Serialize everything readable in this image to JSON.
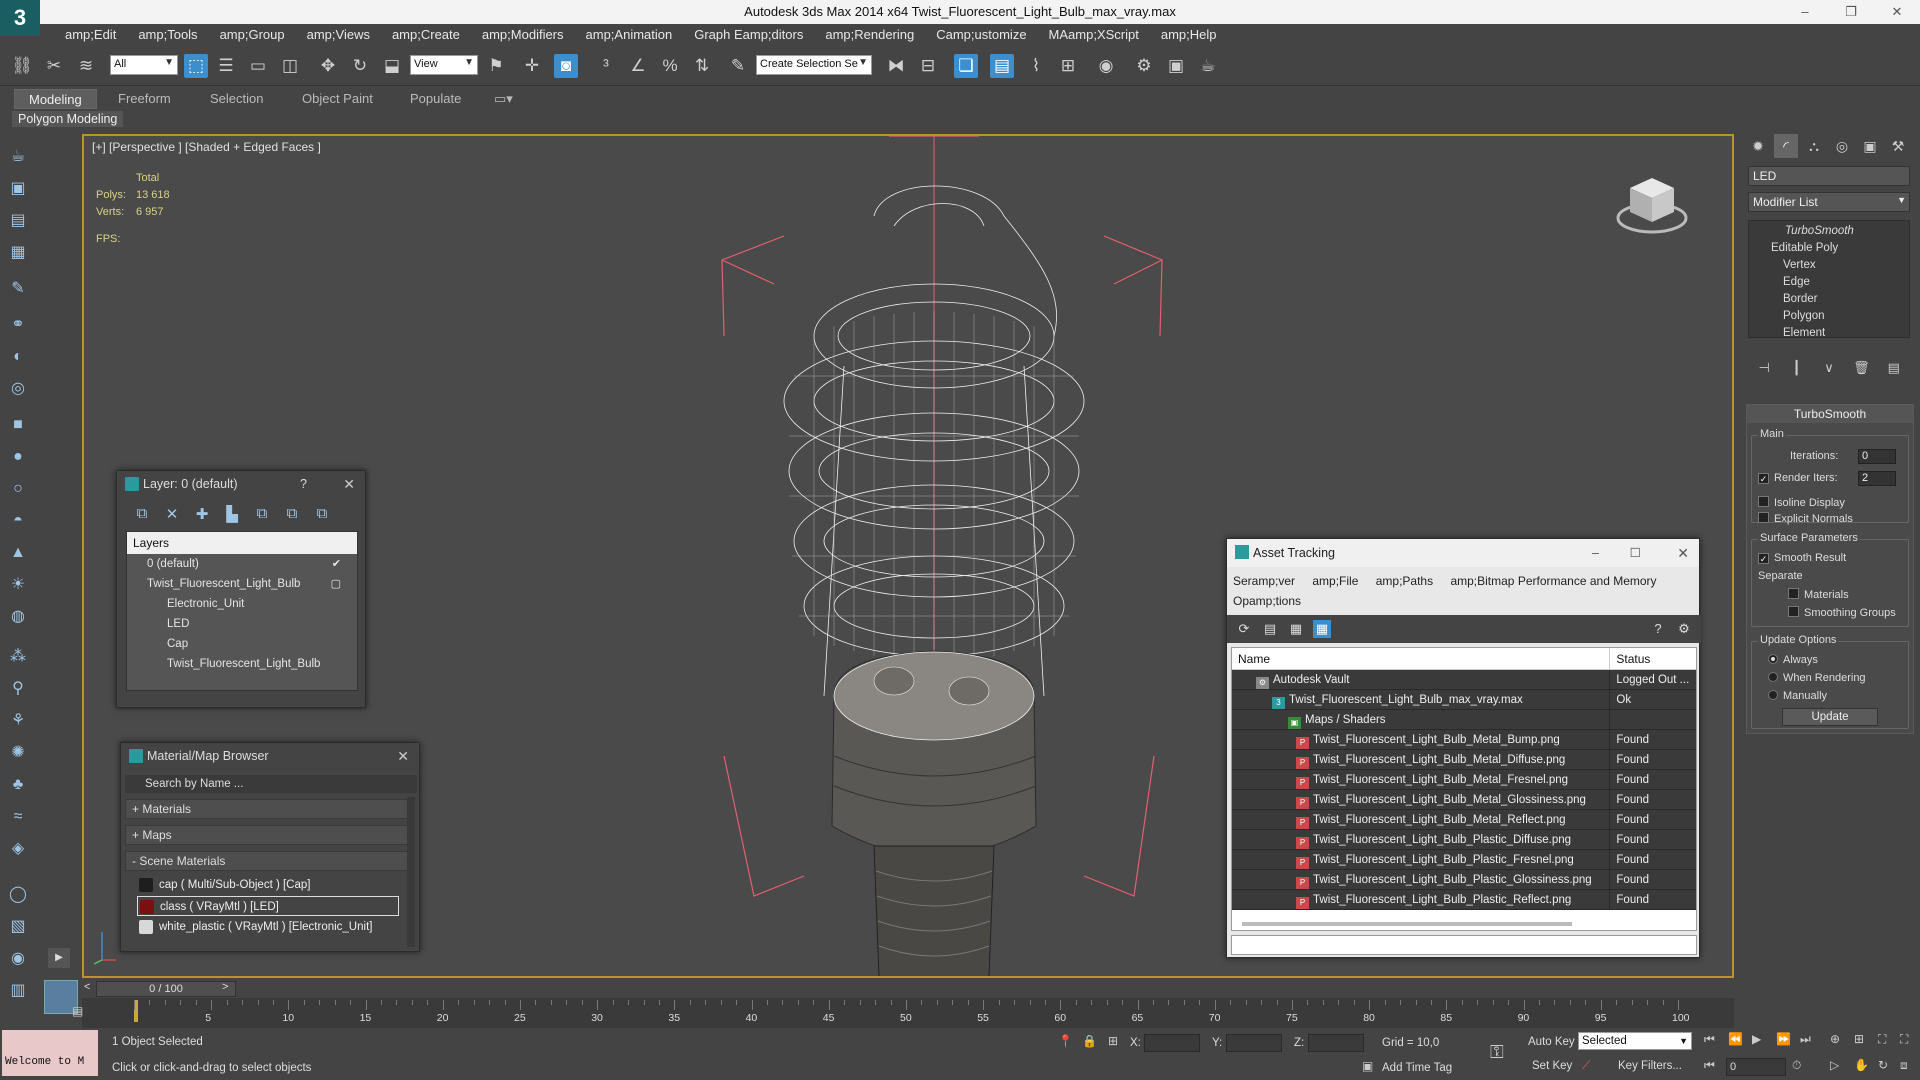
{
  "app": {
    "title": "Autodesk 3ds Max  2014 x64     Twist_Fluorescent_Light_Bulb_max_vray.max",
    "logo": "3",
    "controls": [
      "–",
      "❐",
      "✕"
    ]
  },
  "menu": [
    "amp;Edit",
    "amp;Tools",
    "amp;Group",
    "amp;Views",
    "amp;Create",
    "amp;Modifiers",
    "amp;Animation",
    "Graph Eamp;ditors",
    "amp;Rendering",
    "Camp;ustomize",
    "MAamp;XScript",
    "amp;Help"
  ],
  "toolbar": {
    "filter_value": "All",
    "refcoord_value": "View",
    "selection_set_placeholder": "Create Selection Se"
  },
  "ribbon": {
    "tabs": [
      "Modeling",
      "Freeform",
      "Selection",
      "Object Paint",
      "Populate"
    ],
    "active_tab": "Modeling",
    "sub_label": "Polygon Modeling"
  },
  "viewport": {
    "label": "[+] [Perspective ] [Shaded + Edged Faces ]",
    "stats_header": "Total",
    "polys_label": "Polys:",
    "polys_value": "13 618",
    "verts_label": "Verts:",
    "verts_value": "6 957",
    "fps_label": "FPS:"
  },
  "command_panel": {
    "object_name": "LED",
    "modifier_list": "Modifier List",
    "stack": [
      "TurboSmooth",
      "Editable Poly",
      "Vertex",
      "Edge",
      "Border",
      "Polygon",
      "Element"
    ],
    "turbosmooth": {
      "title": "TurboSmooth",
      "main": "Main",
      "iterations_label": "Iterations:",
      "iterations_value": "0",
      "render_iters_label": "Render Iters:",
      "render_iters_value": "2",
      "isoline": "Isoline Display",
      "explicit_normals": "Explicit Normals",
      "surface_params": "Surface Parameters",
      "smooth_result": "Smooth Result",
      "separate": "Separate",
      "materials": "Materials",
      "smoothing_groups": "Smoothing Groups",
      "update_options": "Update Options",
      "always": "Always",
      "when_rendering": "When Rendering",
      "manually": "Manually",
      "update_button": "Update"
    }
  },
  "layer_window": {
    "title": "Layer: 0 (default)",
    "help": "?",
    "close": "✕",
    "header": "Layers",
    "rows": [
      {
        "label": "0 (default)",
        "indent": 1,
        "mark": "✔"
      },
      {
        "label": "Twist_Fluorescent_Light_Bulb",
        "indent": 1,
        "mark": "▢"
      },
      {
        "label": "Electronic_Unit",
        "indent": 2,
        "mark": ""
      },
      {
        "label": "LED",
        "indent": 2,
        "mark": ""
      },
      {
        "label": "Cap",
        "indent": 2,
        "mark": ""
      },
      {
        "label": "Twist_Fluorescent_Light_Bulb",
        "indent": 2,
        "mark": ""
      }
    ]
  },
  "material_browser": {
    "title": "Material/Map Browser",
    "close": "✕",
    "search_placeholder": "Search by Name ...",
    "sections": [
      "+ Materials",
      "+ Maps",
      "- Scene Materials"
    ],
    "items": [
      {
        "label": "cap  ( Multi/Sub-Object )  [Cap]",
        "color": "#1e1e1e"
      },
      {
        "label": "class  ( VRayMtl )  [LED]",
        "color": "#7a1010"
      },
      {
        "label": "white_plastic  ( VRayMtl )  [Electronic_Unit]",
        "color": "#d8d8d8"
      }
    ]
  },
  "asset_tracking": {
    "title": "Asset Tracking",
    "menu": [
      "Seramp;ver",
      "amp;File",
      "amp;Paths",
      "amp;Bitmap Performance and Memory"
    ],
    "menu2": "Opamp;tions",
    "col_name": "Name",
    "col_status": "Status",
    "rows": [
      {
        "name": "Autodesk Vault",
        "status": "Logged Out ...",
        "indent": 1,
        "icon": "vault"
      },
      {
        "name": "Twist_Fluorescent_Light_Bulb_max_vray.max",
        "status": "Ok",
        "indent": 2,
        "icon": "max"
      },
      {
        "name": "Maps / Shaders",
        "status": "",
        "indent": 3,
        "icon": "maps"
      },
      {
        "name": "Twist_Fluorescent_Light_Bulb_Metal_Bump.png",
        "status": "Found",
        "indent": 4,
        "icon": "png"
      },
      {
        "name": "Twist_Fluorescent_Light_Bulb_Metal_Diffuse.png",
        "status": "Found",
        "indent": 4,
        "icon": "png"
      },
      {
        "name": "Twist_Fluorescent_Light_Bulb_Metal_Fresnel.png",
        "status": "Found",
        "indent": 4,
        "icon": "png"
      },
      {
        "name": "Twist_Fluorescent_Light_Bulb_Metal_Glossiness.png",
        "status": "Found",
        "indent": 4,
        "icon": "png"
      },
      {
        "name": "Twist_Fluorescent_Light_Bulb_Metal_Reflect.png",
        "status": "Found",
        "indent": 4,
        "icon": "png"
      },
      {
        "name": "Twist_Fluorescent_Light_Bulb_Plastic_Diffuse.png",
        "status": "Found",
        "indent": 4,
        "icon": "png"
      },
      {
        "name": "Twist_Fluorescent_Light_Bulb_Plastic_Fresnel.png",
        "status": "Found",
        "indent": 4,
        "icon": "png"
      },
      {
        "name": "Twist_Fluorescent_Light_Bulb_Plastic_Glossiness.png",
        "status": "Found",
        "indent": 4,
        "icon": "png"
      },
      {
        "name": "Twist_Fluorescent_Light_Bulb_Plastic_Reflect.png",
        "status": "Found",
        "indent": 4,
        "icon": "png"
      }
    ]
  },
  "timeline": {
    "frame": "0 / 100",
    "prev": "<",
    "next": ">",
    "ticks": [
      "5",
      "10",
      "15",
      "20",
      "25",
      "30",
      "35",
      "40",
      "45",
      "50",
      "55",
      "60",
      "65",
      "70",
      "75",
      "80",
      "85",
      "90",
      "95",
      "100"
    ]
  },
  "status": {
    "welcome": "Welcome to M",
    "selected": "1 Object Selected",
    "prompt": "Click or click-and-drag to select objects",
    "x_label": "X:",
    "y_label": "Y:",
    "z_label": "Z:",
    "grid": "Grid = 10,0",
    "add_time_tag": "Add Time Tag",
    "auto_key": "Auto Key",
    "set_key": "Set Key",
    "selected_dropdown": "Selected",
    "key_filters": "Key Filters...",
    "frame_value": "0"
  },
  "colors": {
    "accent": "#3c8fcf",
    "viewport_border": "#b8952a",
    "stats": "#d8d28a"
  }
}
